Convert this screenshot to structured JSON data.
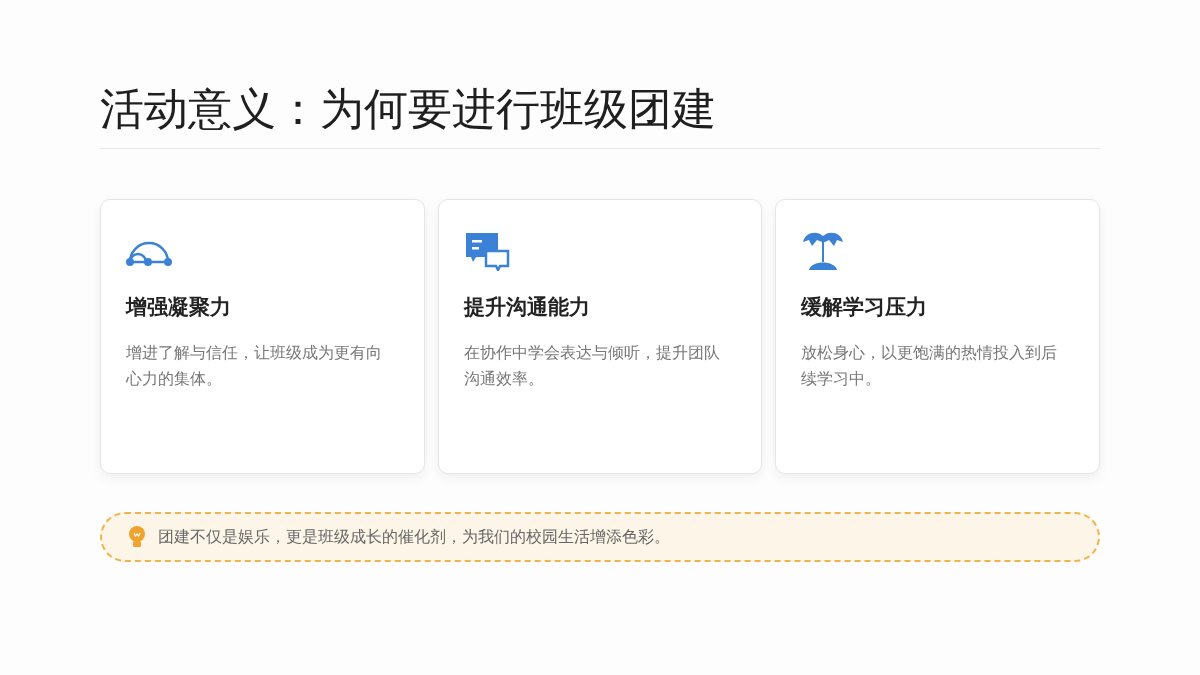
{
  "title": "活动意义：为何要进行班级团建",
  "cards": [
    {
      "kind": "arc",
      "title": "增强凝聚力",
      "text": "增进了解与信任，让班级成为更有向心力的集体。"
    },
    {
      "kind": "chat",
      "title": "提升沟通能力",
      "text": "在协作中学会表达与倾听，提升团队沟通效率。"
    },
    {
      "kind": "palm",
      "title": "缓解学习压力",
      "text": "放松身心，以更饱满的热情投入到后续学习中。"
    }
  ],
  "note": "团建不仅是娱乐，更是班级成长的催化剂，为我们的校园生活增添色彩。"
}
